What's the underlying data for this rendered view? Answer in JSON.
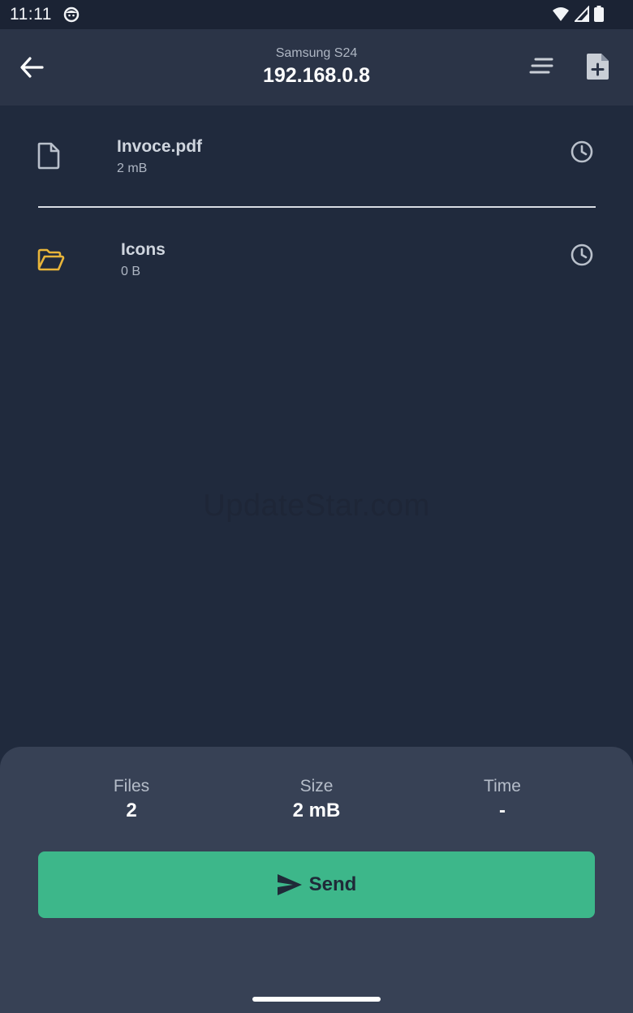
{
  "status_bar": {
    "time": "11:11"
  },
  "app_bar": {
    "device_name": "Samsung S24",
    "address": "192.168.0.8",
    "back_icon": "arrow-left-icon",
    "sort_icon": "sort-lines-icon",
    "add_file_icon": "file-plus-icon"
  },
  "files": [
    {
      "name": "Invoce.pdf",
      "size": "2 mB",
      "type": "file",
      "icon": "file-icon"
    },
    {
      "name": "Icons",
      "size": "0 B",
      "type": "folder",
      "icon": "folder-icon"
    }
  ],
  "watermark": "UpdateStar.com",
  "summary": {
    "files_label": "Files",
    "files_value": "2",
    "size_label": "Size",
    "size_value": "2 mB",
    "time_label": "Time",
    "time_value": "-"
  },
  "send_button": {
    "label": "Send",
    "icon": "send-icon"
  },
  "colors": {
    "accent": "#3db78a",
    "folder": "#e8b53a",
    "background": "#202a3d",
    "sheet": "#374155"
  }
}
